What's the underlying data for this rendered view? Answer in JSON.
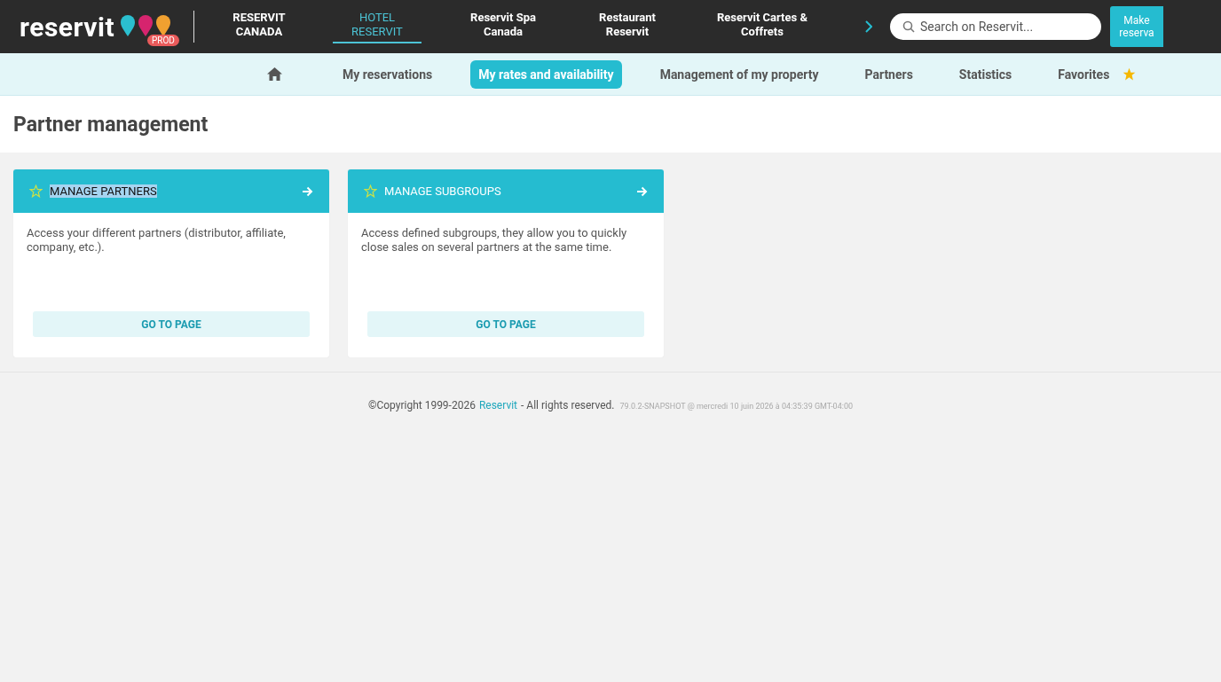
{
  "header": {
    "logo": "reservit",
    "environment": "PROD",
    "tabs": [
      {
        "label": "RESERVIT CANADA",
        "selected": false
      },
      {
        "label": "HOTEL RESERVIT",
        "selected": true
      },
      {
        "label": "Reservit Spa Canada",
        "selected": false
      },
      {
        "label": "Restaurant Reservit",
        "selected": false
      },
      {
        "label": "Reservit Cartes & Coffrets",
        "selected": false
      }
    ],
    "search": {
      "placeholder": "Search on Reservit..."
    },
    "action_button": "Make reserva"
  },
  "subnav": [
    {
      "kind": "home",
      "selected": false
    },
    {
      "kind": "link",
      "label": "My reservations",
      "selected": false
    },
    {
      "kind": "link",
      "label": "My rates and availability",
      "selected": true
    },
    {
      "kind": "link",
      "label": "Management of my property",
      "selected": false
    },
    {
      "kind": "link",
      "label": "Partners",
      "selected": false
    },
    {
      "kind": "link",
      "label": "Statistics",
      "selected": false
    },
    {
      "kind": "favorites",
      "label": "Favorites",
      "selected": false
    }
  ],
  "page_title": "Partner management",
  "cards": [
    {
      "title": "MANAGE PARTNERS",
      "title_highlighted": true,
      "description": "Access your different partners (distributor, affiliate, company, etc.).",
      "button": "GO TO PAGE"
    },
    {
      "title": "MANAGE SUBGROUPS",
      "title_highlighted": false,
      "description": "Access defined subgroups, they allow you to quickly close sales on several partners at the same time.",
      "button": "GO TO PAGE"
    }
  ],
  "footer": {
    "copyright": "©Copyright 1999-2026",
    "link": "Reservit",
    "rights": "- All rights reserved.",
    "version": "79.0.2-SNAPSHOT @ mercredi 10 juin 2026 à 04:35:39 GMT-04:00"
  }
}
